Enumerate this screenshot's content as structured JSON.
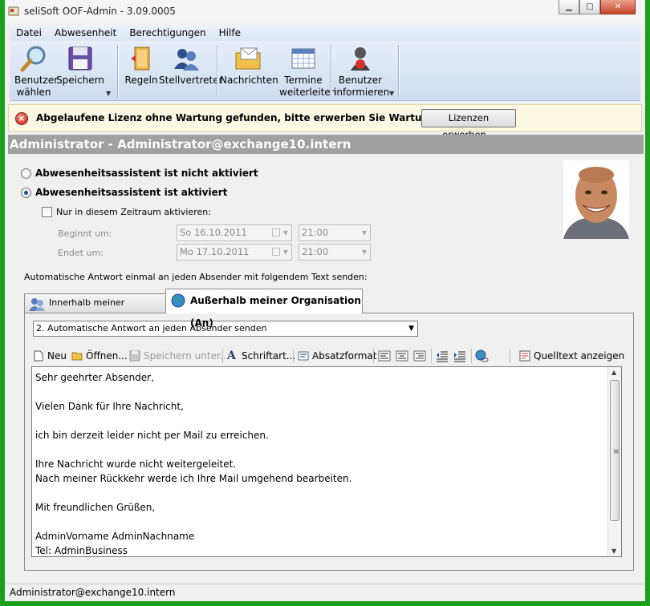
{
  "window": {
    "title": "seliSoft OOF-Admin - 3.09.0005"
  },
  "menu": [
    "Datei",
    "Abwesenheit",
    "Berechtigungen",
    "Hilfe"
  ],
  "toolbar": {
    "benutzer_waehlen": [
      "Benutzer",
      "wählen"
    ],
    "speichern": "Speichern",
    "regeln": "Regeln",
    "stellvertreter": "Stellvertreter",
    "nachrichten": "Nachrichten",
    "termine_weiterleiten": [
      "Termine",
      "weiterleiten"
    ],
    "benutzer_informieren": [
      "Benutzer",
      "informieren"
    ]
  },
  "license": {
    "message": "Abgelaufene Lizenz ohne Wartung gefunden, bitte erwerben Sie Wartungslizenzen.",
    "button": "Lizenzen erwerben..."
  },
  "header": {
    "user": "Administrator - Administrator@exchange10.intern"
  },
  "assistant": {
    "inactive_label": "Abwesenheitsassistent ist nicht aktiviert",
    "active_label": "Abwesenheitsassistent ist aktiviert",
    "active": true,
    "period_label": "Nur in diesem Zeitraum aktivieren:",
    "period_checked": false,
    "begin_label": "Beginnt um:",
    "end_label": "Endet um:",
    "begin_date": "So 16.10.2011",
    "begin_time": "21:00",
    "end_date": "Mo 17.10.2011",
    "end_time": "21:00"
  },
  "reply_label": "Automatische Antwort einmal an jeden Absender mit folgendem Text senden:",
  "tabs": {
    "inside": "Innerhalb meiner Organisation",
    "outside": "Außerhalb meiner Organisation (An)"
  },
  "mode_select": "2. Automatische Antwort an jeden Absender senden",
  "editor_toolbar": {
    "new": "Neu",
    "open": "Öffnen...",
    "save_as": "Speichern unter...",
    "font": "Schriftart...",
    "paragraph": "Absatzformat",
    "source": "Quelltext anzeigen"
  },
  "message_text": "Sehr geehrter Absender,\n\nVielen Dank für Ihre Nachricht,\n\nich bin derzeit leider nicht per Mail zu erreichen.\n\nIhre Nachricht wurde nicht weitergeleitet.\nNach meiner Rückkehr werde ich Ihre Mail umgehend bearbeiten.\n\nMit freundlichen Grüßen,\n\nAdminVorname AdminNachname\nTel: AdminBusiness",
  "status": "Administrator@exchange10.intern"
}
